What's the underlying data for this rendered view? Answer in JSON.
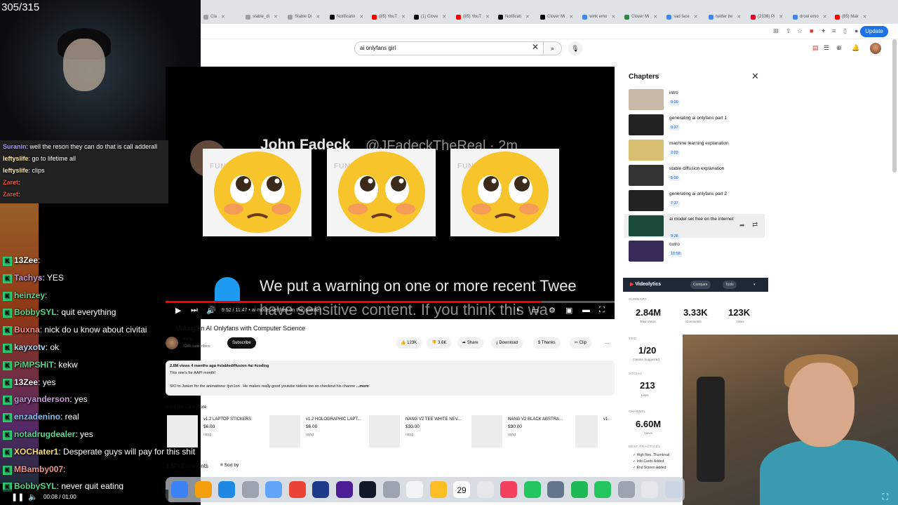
{
  "overlay": {
    "counter": "305/315"
  },
  "browser": {
    "tabs": [
      {
        "label": "Cla",
        "color": "#9aa0a6"
      },
      {
        "label": "stable_di",
        "color": "#9aa0a6"
      },
      {
        "label": "Stable Di",
        "color": "#9aa0a6"
      },
      {
        "label": "Notificatio",
        "color": "#000000"
      },
      {
        "label": "(85) YouT",
        "color": "#ff0000"
      },
      {
        "label": "(1) Clove",
        "color": "#000000"
      },
      {
        "label": "(85) YouT",
        "color": "#ff0000"
      },
      {
        "label": "Notificati",
        "color": "#000000"
      },
      {
        "label": "Clover Mi",
        "color": "#000000"
      },
      {
        "label": "wink emo",
        "color": "#4285f4"
      },
      {
        "label": "Clover Mi",
        "color": "#2b8a3e"
      },
      {
        "label": "sad face",
        "color": "#4285f4"
      },
      {
        "label": "twitter be",
        "color": "#4285f4"
      },
      {
        "label": "(2336) Pi",
        "color": "#e60023"
      },
      {
        "label": "drool emo",
        "color": "#4285f4"
      },
      {
        "label": "(85) Mak",
        "color": "#ff0000"
      }
    ],
    "update_label": "Update"
  },
  "youtube": {
    "search_value": "ai onlyfans girl",
    "player": {
      "tweet_name": "John Fadeck",
      "tweet_handle": "@JFadeckTheReal · 2m",
      "warning_line1": "We put a warning on one or more recent Twee",
      "warning_line2": "have sensitive content. If you think this wa",
      "watermark": "FUNNICON",
      "time": "9:52 / 11:47",
      "chapter_label": "ai model set free on the internet",
      "progress": 0.837
    },
    "video_title": "Making an AI Onlyfans with Computer Science",
    "channel": {
      "name": "nang",
      "subs": "134K subscribers"
    },
    "subscribe_label": "Subscribe",
    "likes": "123K",
    "dislikes": "3.6K",
    "actions": [
      "Share",
      "Download",
      "Thanks",
      "Clip"
    ],
    "more_label": "...",
    "description": {
      "stats": "2.8M views  4 months ago  #stablediffusion #ai #coding",
      "line1": "This one's for AAPI month!",
      "line2": "S/O to Junion for the animations:  /jun1on  . He makes really good youtube videos too so checkout his channe",
      "more": "...more"
    },
    "shop": {
      "title": "Shop the nang store",
      "products": [
        {
          "name": "v1.2 LAPTOP STICKERS",
          "price": "$6.00",
          "store": "nang"
        },
        {
          "name": "v1.2 HOLOGRAPHIC LAPT...",
          "price": "$6.00",
          "store": "nang"
        },
        {
          "name": "NANG V2 TEE WHITE NEV...",
          "price": "$30.00",
          "store": "nang"
        },
        {
          "name": "NANG V2 BLACK ABSTRA...",
          "price": "$30.00",
          "store": "nang"
        }
      ],
      "overflow_label": "v1."
    },
    "comments_count": "3,326 Comments",
    "sort_label": "Sort by",
    "chapters": {
      "title": "Chapters",
      "items": [
        {
          "name": "intro",
          "time": "0:00",
          "thumb": "#c8b8a8"
        },
        {
          "name": "generating ai onlyfans part 1",
          "time": "0:37",
          "thumb": "#222222"
        },
        {
          "name": "machine learning explanation",
          "time": "2:03",
          "thumb": "#d8c070"
        },
        {
          "name": "stable diffusion explanation",
          "time": "5:00",
          "thumb": "#333333"
        },
        {
          "name": "generating ai onlyfans part 2",
          "time": "7:37",
          "thumb": "#222222"
        },
        {
          "name": "ai model set free on the internet",
          "time": "9:38",
          "thumb": "#1a4a3a",
          "active": true
        },
        {
          "name": "outro",
          "time": "10:58",
          "thumb": "#3a2a5a"
        }
      ]
    },
    "videolytics": {
      "brand": "Videolytics",
      "compare_label": "Compare",
      "tools_label": "Tools",
      "summary_label": "SUMMARY",
      "total_views": "2.84M",
      "total_views_label": "Total Views",
      "comments": "3.33K",
      "comments_label": "Comments",
      "likes": "123K",
      "likes_label": "Likes",
      "seo_label": "SEO",
      "seo_value": "1/20",
      "seo_sub": "Creator Suggested",
      "social_label": "SOCIAL",
      "social_value": "213",
      "social_sub": "Likes",
      "channel_label": "CHANNEL",
      "channel_value": "6.60M",
      "channel_sub": "Views",
      "best_label": "BEST PRACTICES",
      "practices": [
        "High Res. Thumbnail",
        "Info Cards Added",
        "End Screen Added"
      ]
    }
  },
  "chat_top": [
    {
      "user": "Suranin",
      "msg": ": well the reson they can do that is call adderall"
    },
    {
      "user": "leftyslife",
      "msg": ": go to lifetime all"
    },
    {
      "user": "leftyslife",
      "msg": ": clips"
    },
    {
      "user": "Zaret",
      "msg": ":"
    },
    {
      "user": "Zaret",
      "msg": ":"
    }
  ],
  "chat_bottom": [
    {
      "user": "13Zee",
      "msg": ":",
      "color": "#ffffff"
    },
    {
      "user": "Tachys",
      "msg": ": YES",
      "color": "#c39bd3"
    },
    {
      "user": "heinzey",
      "msg": ":",
      "color": "#58d68d"
    },
    {
      "user": "BobbySYL",
      "msg": ": quit everything",
      "color": "#58d68d"
    },
    {
      "user": "Buxna",
      "msg": ": nick do u know about civitai",
      "color": "#f1948a"
    },
    {
      "user": "kayxotv",
      "msg": ": ok",
      "color": "#aed6f1"
    },
    {
      "user": "PiMPSHiT",
      "msg": ": kekw",
      "color": "#58d68d"
    },
    {
      "user": "13Zee",
      "msg": ": yes",
      "color": "#ffffff"
    },
    {
      "user": "garyanderson",
      "msg": ": yes",
      "color": "#c39bd3"
    },
    {
      "user": "enzadenino",
      "msg": ": real",
      "color": "#85c1e9"
    },
    {
      "user": "notadrugdealer",
      "msg": ": yes",
      "color": "#58d68d"
    },
    {
      "user": "XOCHater1",
      "msg": ": Desperate guys will pay for this shit",
      "color": "#f7dc6f"
    },
    {
      "user": "MBamby007",
      "msg": ":",
      "color": "#f1948a"
    },
    {
      "user": "BobbySYL",
      "msg": ": never quit eating",
      "color": "#58d68d"
    }
  ],
  "stream_bar": {
    "time": "00:08 / 01:00"
  },
  "dock": {
    "calendar_day": "29",
    "icons": [
      "#3b82f6",
      "#f59e0b",
      "#1e88e5",
      "#9ca3af",
      "#60a5fa",
      "#ea4335",
      "#1e3a8a",
      "#4c1d95",
      "#111827",
      "#9ca3af",
      "#f3f4f6",
      "#fbbf24",
      "#ffffff",
      "#e5e7eb",
      "#f43f5e",
      "#22c55e",
      "#64748b",
      "#1db954",
      "#22c55e",
      "#9ca3af",
      "#e5e7eb",
      "#cbd5e1"
    ]
  }
}
